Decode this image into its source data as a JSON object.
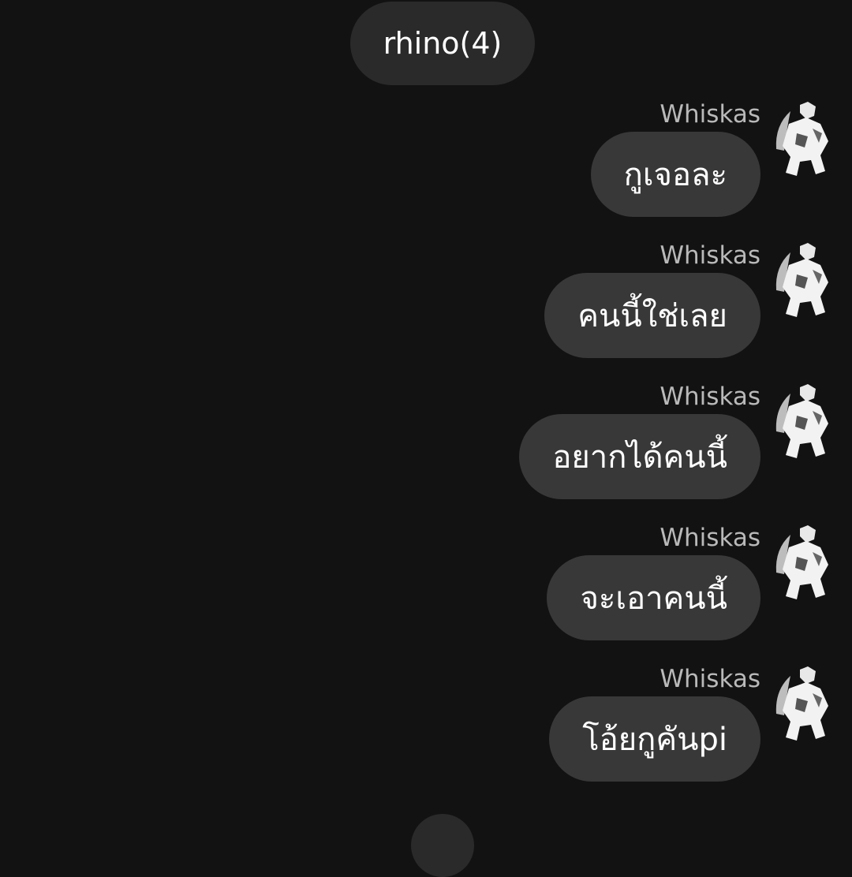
{
  "header": {
    "title": "rhino(4)"
  },
  "messages": [
    {
      "sender": "Whiskas",
      "text": "กูเจอละ"
    },
    {
      "sender": "Whiskas",
      "text": "คนนี้ใช่เลย"
    },
    {
      "sender": "Whiskas",
      "text": "อยากได้คนนี้"
    },
    {
      "sender": "Whiskas",
      "text": "จะเอาคนนี้"
    },
    {
      "sender": "Whiskas",
      "text": "โอ้ยกูคันpi"
    }
  ],
  "colors": {
    "background": "#121212",
    "bubble": "#383838",
    "pill": "#2a2a2a",
    "sender_text": "#b9b9b9",
    "message_text": "#ffffff"
  },
  "icons": {
    "avatar": "user-avatar-icon"
  }
}
